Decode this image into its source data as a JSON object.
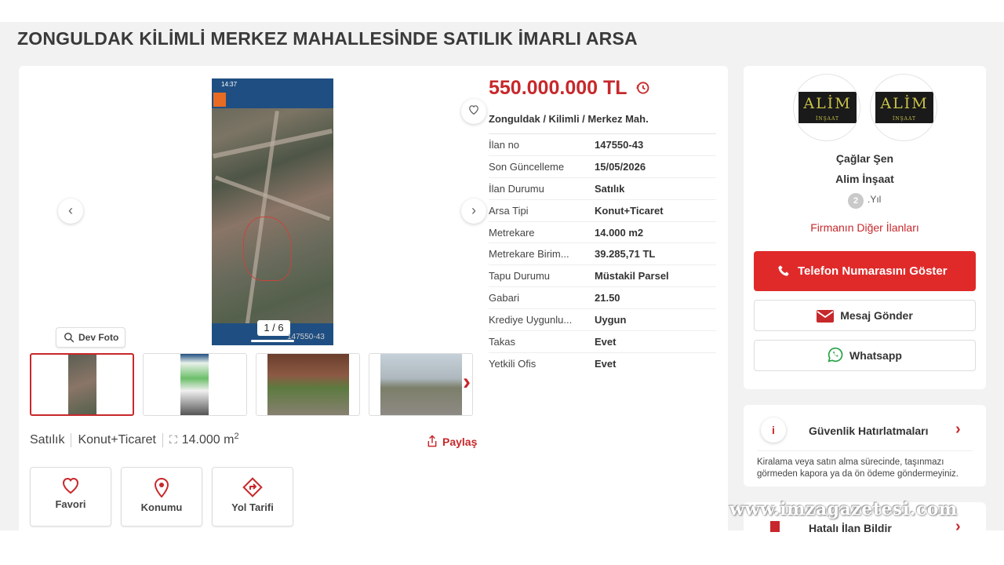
{
  "listing": {
    "title": "ZONGULDAK KİLİMLİ MERKEZ MAHALLESİNDE SATILIK İMARLI ARSA",
    "price": "550.000.000 TL",
    "location": "Zonguldak / Kilimli / Merkez Mah.",
    "details": [
      {
        "label": "İlan no",
        "value": "147550-43"
      },
      {
        "label": "Son Güncelleme",
        "value": "15/05/2026"
      },
      {
        "label": "İlan Durumu",
        "value": "Satılık"
      },
      {
        "label": "Arsa Tipi",
        "value": "Konut+Ticaret"
      },
      {
        "label": "Metrekare",
        "value": "14.000 m2"
      },
      {
        "label": "Metrekare Birim...",
        "value": "39.285,71 TL"
      },
      {
        "label": "Tapu Durumu",
        "value": "Müstakil Parsel"
      },
      {
        "label": "Gabari",
        "value": "21.50"
      },
      {
        "label": "Krediye Uygunlu...",
        "value": "Uygun"
      },
      {
        "label": "Takas",
        "value": "Evet"
      },
      {
        "label": "Yetkili Ofis",
        "value": "Evet"
      }
    ]
  },
  "gallery": {
    "counter": "1 / 6",
    "photo_id": "147550-43",
    "dev_foto_label": "Dev Foto"
  },
  "summary": {
    "status": "Satılık",
    "type": "Konut+Ticaret",
    "area": "14.000 m",
    "area_sup": "2",
    "share_label": "Paylaş"
  },
  "actions": {
    "favorite": "Favori",
    "location": "Konumu",
    "directions": "Yol Tarifi"
  },
  "seller": {
    "person": "Çağlar Şen",
    "company": "Alim İnşaat",
    "logo_text": "ALİM",
    "logo_sub": "İNŞAAT",
    "medal": "2",
    "years_label": ".Yıl",
    "other_ads": "Firmanın Diğer İlanları",
    "phone_btn": "Telefon Numarasını Göster",
    "message_btn": "Mesaj Gönder",
    "whatsapp_btn": "Whatsapp"
  },
  "safety": {
    "title": "Güvenlik Hatırlatmaları",
    "text": "Kiralama veya satın alma sürecinde, taşınmazı görmeden kapora ya da ön ödeme göndermeyiniz."
  },
  "report": {
    "title": "Hatalı İlan Bildir"
  },
  "watermark": "www.imzagazetesi.com",
  "colors": {
    "accent": "#c7282b",
    "phone_button": "#e02a2a",
    "background": "#f2f2f2"
  }
}
